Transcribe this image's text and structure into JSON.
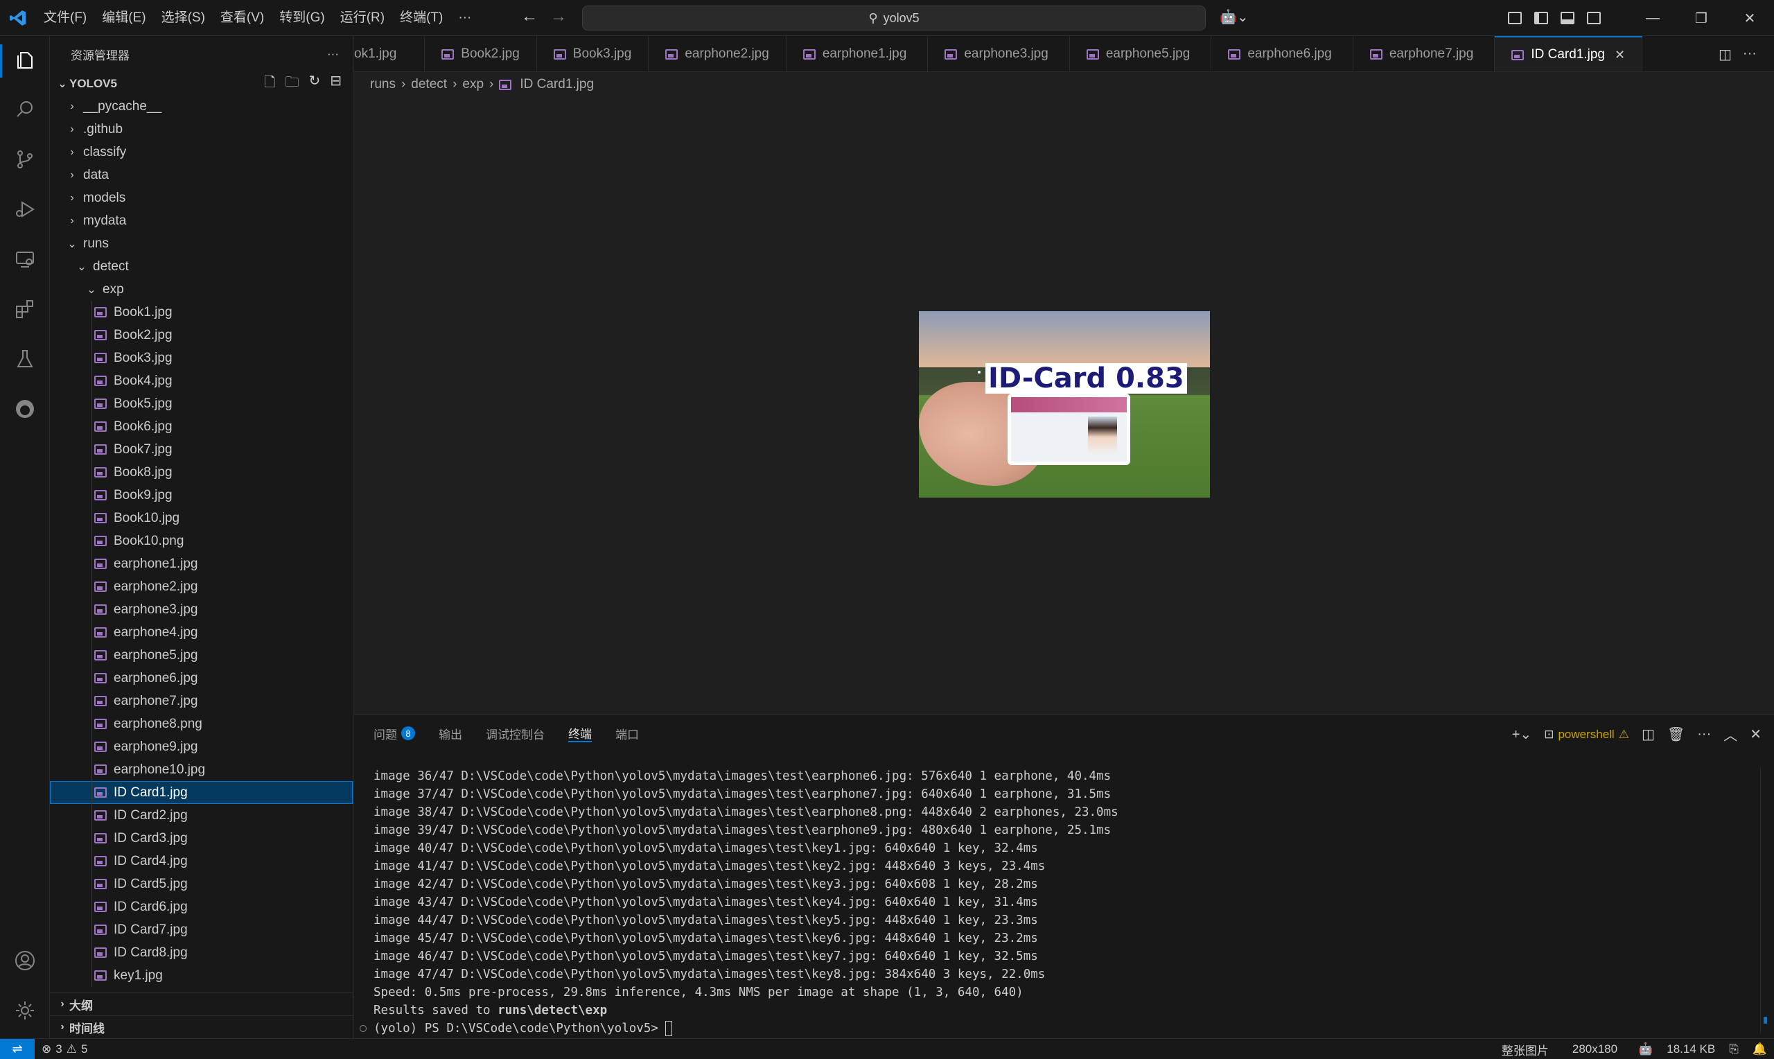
{
  "menu": [
    "文件(F)",
    "编辑(E)",
    "选择(S)",
    "查看(V)",
    "转到(G)",
    "运行(R)",
    "终端(T)",
    "···"
  ],
  "search": {
    "text": "yolov5"
  },
  "sidebar": {
    "title": "资源管理器",
    "more": "···",
    "root": "YOLOV5",
    "folders": [
      "__pycache__",
      ".github",
      "classify",
      "data",
      "models",
      "mydata"
    ],
    "runs": "runs",
    "detect": "detect",
    "exp": "exp",
    "files": [
      "Book1.jpg",
      "Book2.jpg",
      "Book3.jpg",
      "Book4.jpg",
      "Book5.jpg",
      "Book6.jpg",
      "Book7.jpg",
      "Book8.jpg",
      "Book9.jpg",
      "Book10.jpg",
      "Book10.png",
      "earphone1.jpg",
      "earphone2.jpg",
      "earphone3.jpg",
      "earphone4.jpg",
      "earphone5.jpg",
      "earphone6.jpg",
      "earphone7.jpg",
      "earphone8.png",
      "earphone9.jpg",
      "earphone10.jpg",
      "ID Card1.jpg",
      "ID Card2.jpg",
      "ID Card3.jpg",
      "ID Card4.jpg",
      "ID Card5.jpg",
      "ID Card6.jpg",
      "ID Card7.jpg",
      "ID Card8.jpg",
      "key1.jpg"
    ],
    "selected_index": 21,
    "outline": "大纲",
    "timeline": "时间线"
  },
  "tabs": [
    {
      "label": "ok1.jpg"
    },
    {
      "label": "Book2.jpg"
    },
    {
      "label": "Book3.jpg"
    },
    {
      "label": "earphone2.jpg"
    },
    {
      "label": "earphone1.jpg"
    },
    {
      "label": "earphone3.jpg"
    },
    {
      "label": "earphone5.jpg"
    },
    {
      "label": "earphone6.jpg"
    },
    {
      "label": "earphone7.jpg"
    },
    {
      "label": "ID Card1.jpg",
      "active": true
    }
  ],
  "breadcrumb": [
    "runs",
    "detect",
    "exp",
    "ID Card1.jpg"
  ],
  "preview": {
    "detection_label": "ID-Card  0.83"
  },
  "panel": {
    "tabs": [
      {
        "label": "问题",
        "badge": "8"
      },
      {
        "label": "输出"
      },
      {
        "label": "调试控制台"
      },
      {
        "label": "终端",
        "active": true
      },
      {
        "label": "端口"
      }
    ],
    "shell": "powershell",
    "terminal_lines": [
      "image 36/47 D:\\VSCode\\code\\Python\\yolov5\\mydata\\images\\test\\earphone6.jpg: 576x640 1 earphone, 40.4ms",
      "image 37/47 D:\\VSCode\\code\\Python\\yolov5\\mydata\\images\\test\\earphone7.jpg: 640x640 1 earphone, 31.5ms",
      "image 38/47 D:\\VSCode\\code\\Python\\yolov5\\mydata\\images\\test\\earphone8.png: 448x640 2 earphones, 23.0ms",
      "image 39/47 D:\\VSCode\\code\\Python\\yolov5\\mydata\\images\\test\\earphone9.jpg: 480x640 1 earphone, 25.1ms",
      "image 40/47 D:\\VSCode\\code\\Python\\yolov5\\mydata\\images\\test\\key1.jpg: 640x640 1 key, 32.4ms",
      "image 41/47 D:\\VSCode\\code\\Python\\yolov5\\mydata\\images\\test\\key2.jpg: 448x640 3 keys, 23.4ms",
      "image 42/47 D:\\VSCode\\code\\Python\\yolov5\\mydata\\images\\test\\key3.jpg: 640x608 1 key, 28.2ms",
      "image 43/47 D:\\VSCode\\code\\Python\\yolov5\\mydata\\images\\test\\key4.jpg: 640x640 1 key, 31.4ms",
      "image 44/47 D:\\VSCode\\code\\Python\\yolov5\\mydata\\images\\test\\key5.jpg: 448x640 1 key, 23.3ms",
      "image 45/47 D:\\VSCode\\code\\Python\\yolov5\\mydata\\images\\test\\key6.jpg: 448x640 1 key, 23.2ms",
      "image 46/47 D:\\VSCode\\code\\Python\\yolov5\\mydata\\images\\test\\key7.jpg: 640x640 1 key, 32.5ms",
      "image 47/47 D:\\VSCode\\code\\Python\\yolov5\\mydata\\images\\test\\key8.jpg: 384x640 3 keys, 22.0ms",
      "Speed: 0.5ms pre-process, 29.8ms inference, 4.3ms NMS per image at shape (1, 3, 640, 640)"
    ],
    "results_prefix": "Results saved to ",
    "results_path": "runs\\detect\\exp",
    "prompt": "(yolo) PS D:\\VSCode\\code\\Python\\yolov5> "
  },
  "status": {
    "errors": "3",
    "warnings": "5",
    "image_mode": "整张图片",
    "dimensions": "280x180",
    "size": "18.14 KB"
  },
  "colors": {
    "accent": "#0078d4",
    "image_icon": "#a074c4",
    "warning": "#cca700"
  }
}
